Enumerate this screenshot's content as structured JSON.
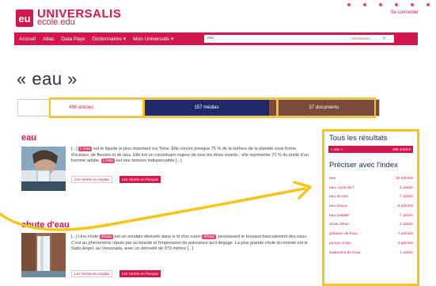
{
  "header": {
    "logo_badge": "eu",
    "logo_main": "UNIVERSALIS",
    "logo_sub": "ecole.edu",
    "connect_link": "Se connecter"
  },
  "nav": {
    "items": [
      "Accueil",
      "Atlas",
      "Data Pays",
      "Dictionnaires ▾",
      "Mon Universalis ▾"
    ],
    "search_value": "eau",
    "reset_label": "Réinitialiser",
    "clear_label": "✕"
  },
  "page": {
    "title": "« eau »"
  },
  "tabs": {
    "articles": "496 articles",
    "medias": "157 médias",
    "documents": "37 documents"
  },
  "results": [
    {
      "title": "eau",
      "snippet_pre": "[...] ",
      "hit1": "L'eau",
      "snippet_mid": " est le liquide le plus important sur Terre. Elle couvre presque 75 % de la surface de la planète sous forme d'océans, de fleuves et de lacs. Elle est un constituant majeur de tous les êtres vivants ; elle représente 70 % du poids d'un homme adulte. ",
      "hit2": "L'eau",
      "snippet_post": " est une boisson indispensable [...]",
      "btn_en": "Lire l'article en anglais",
      "btn_fr": "Lire l'article en français"
    },
    {
      "title": "chute d'eau",
      "snippet_pre": "[...] Une chute ",
      "hit1": "d'eau",
      "snippet_mid": " est un soudain dénivelé dans le lit d'un cours ",
      "hit2": "d'eau",
      "snippet_post": ", provoquant le brusque basculement des eaux. C'est au phénomène rêpuls par su beauté et l'impression de puissance qu'il dégage. La plus grande chute du monde est le Salto Angel, au Venezuela, avec un dénivelé de 979 mètres [...]",
      "btn_en": "Lire l'article en anglais",
      "btn_fr": "Lire l'article en français"
    }
  ],
  "panel": {
    "title_all": "Tous les résultats",
    "active_label": "« eau »",
    "active_count": "496 articles",
    "title_index": "Préciser avec l'index",
    "index": [
      {
        "label": "eau",
        "count": "20 articles"
      },
      {
        "label": "eau, cycle de l'",
        "count": "1 article"
      },
      {
        "label": "eau de mer",
        "count": "7 article"
      },
      {
        "label": "eau douce",
        "count": "6 articles"
      },
      {
        "label": "eau potable",
        "count": "7 article"
      },
      {
        "label": "chute d'eau",
        "count": "1 article"
      },
      {
        "label": "pollution de l'eau",
        "count": "7 articles"
      },
      {
        "label": "pompe à eau",
        "count": "3 articles"
      },
      {
        "label": "traitement de l'eau",
        "count": "1 article"
      }
    ]
  },
  "colors": {
    "brand_red": "#d4174a",
    "navy": "#1f2a6b",
    "brown": "#7b4a3a",
    "highlight_yellow": "#f5c518"
  }
}
